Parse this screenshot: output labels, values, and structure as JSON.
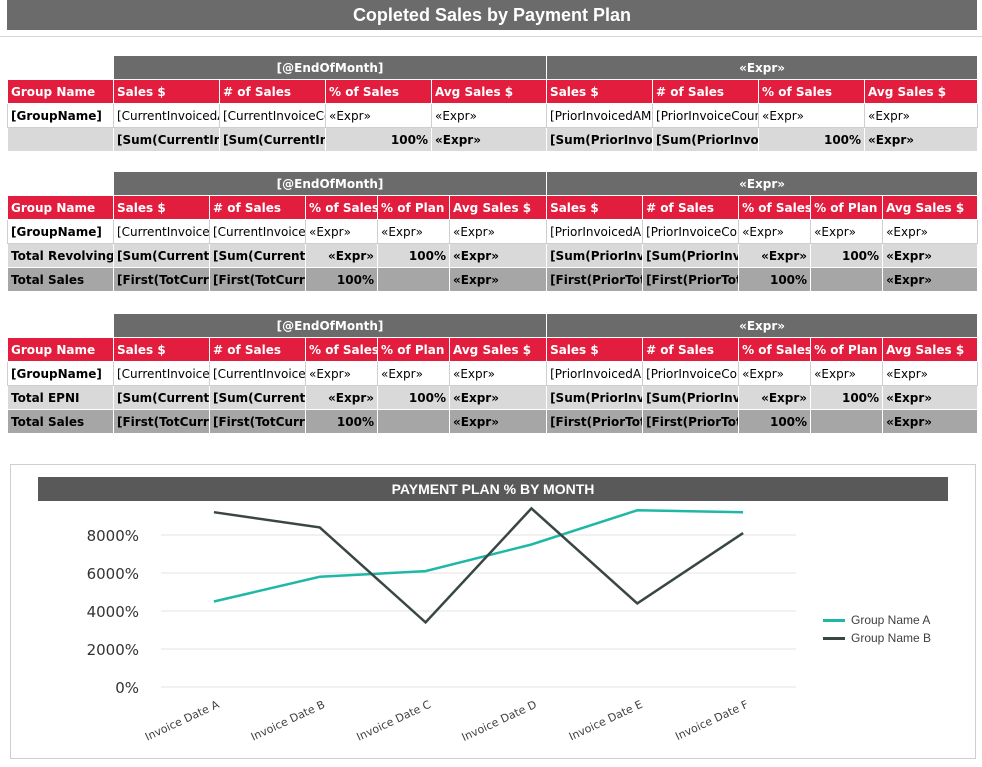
{
  "title": "Copleted Sales by Payment Plan",
  "colors": {
    "header_gray": "#6b6b6b",
    "header_red": "#e21d3d",
    "total_light": "#d9d9d9",
    "total_dark": "#a6a6a6",
    "series_a": "#1fb8a6",
    "series_b": "#3a4645"
  },
  "table1": {
    "group_current": "[@EndOfMonth]",
    "group_prior": "«Expr»",
    "headers": [
      "Group Name",
      "Sales $",
      "# of Sales",
      "% of Sales",
      "Avg Sales $",
      "Sales $",
      "# of Sales",
      "% of Sales",
      "Avg Sales $"
    ],
    "data_row": [
      "[GroupName]",
      "[CurrentInvoicedA",
      "[CurrentInvoiceCo",
      "«Expr»",
      "«Expr»",
      "[PriorInvoicedAM",
      "[PriorInvoiceCoun",
      "«Expr»",
      "«Expr»"
    ],
    "total_row": [
      "",
      "[Sum(CurrentInv",
      "[Sum(CurrentInv",
      "100%",
      "«Expr»",
      "[Sum(PriorInvoi",
      "[Sum(PriorInvoi",
      "100%",
      "«Expr»"
    ]
  },
  "table2": {
    "group_current": "[@EndOfMonth]",
    "group_prior": "«Expr»",
    "headers": [
      "Group Name",
      "Sales $",
      "# of Sales",
      "% of Sales",
      "% of Plan",
      "Avg Sales $",
      "Sales $",
      "# of Sales",
      "% of Sales",
      "% of Plan",
      "Avg Sales $"
    ],
    "data_row": [
      "[GroupName]",
      "[CurrentInvoice",
      "[CurrentInvoice",
      "«Expr»",
      "«Expr»",
      "«Expr»",
      "[PriorInvoicedA",
      "[PriorInvoiceCo",
      "«Expr»",
      "«Expr»",
      "«Expr»"
    ],
    "total_row": [
      "Total Revolving",
      "[Sum(CurrentI",
      "[Sum(CurrentI",
      "«Expr»",
      "100%",
      "«Expr»",
      "[Sum(PriorInv",
      "[Sum(PriorInv",
      "«Expr»",
      "100%",
      "«Expr»"
    ],
    "grand_row": [
      "Total Sales",
      "[First(TotCurre",
      "[First(TotCurre",
      "100%",
      "",
      "«Expr»",
      "[First(PriorTot",
      "[First(PriorTot",
      "100%",
      "",
      "«Expr»"
    ]
  },
  "table3": {
    "group_current": "[@EndOfMonth]",
    "group_prior": "«Expr»",
    "headers": [
      "Group Name",
      "Sales $",
      "# of Sales",
      "% of Sales",
      "% of Plan",
      "Avg Sales $",
      "Sales $",
      "# of Sales",
      "% of Sales",
      "% of Plan",
      "Avg Sales $"
    ],
    "data_row": [
      "[GroupName]",
      "[CurrentInvoice",
      "[CurrentInvoice",
      "«Expr»",
      "«Expr»",
      "«Expr»",
      "[PriorInvoicedA",
      "[PriorInvoiceCo",
      "«Expr»",
      "«Expr»",
      "«Expr»"
    ],
    "total_row": [
      "Total EPNI",
      "[Sum(CurrentI",
      "[Sum(CurrentI",
      "«Expr»",
      "100%",
      "«Expr»",
      "[Sum(PriorInv",
      "[Sum(PriorInv",
      "«Expr»",
      "100%",
      "«Expr»"
    ],
    "grand_row": [
      "Total Sales",
      "[First(TotCurre",
      "[First(TotCurre",
      "100%",
      "",
      "«Expr»",
      "[First(PriorTot",
      "[First(PriorTot",
      "100%",
      "",
      "«Expr»"
    ]
  },
  "chart_title": "PAYMENT PLAN % BY MONTH",
  "chart_data": {
    "type": "line",
    "title": "PAYMENT PLAN % BY MONTH",
    "categories": [
      "Invoice Date A",
      "Invoice Date B",
      "Invoice Date C",
      "Invoice Date D",
      "Invoice Date E",
      "Invoice Date F"
    ],
    "series": [
      {
        "name": "Group Name A",
        "values": [
          4500,
          5800,
          6100,
          7500,
          9300,
          9200
        ]
      },
      {
        "name": "Group Name B",
        "values": [
          9200,
          8400,
          3400,
          9400,
          4400,
          8100
        ]
      }
    ],
    "ylim": [
      0,
      8000
    ],
    "yticks": [
      0,
      2000,
      4000,
      6000,
      8000
    ],
    "ytick_labels": [
      "0%",
      "2000%",
      "4000%",
      "6000%",
      "8000%"
    ],
    "legend": "right",
    "grid": true
  }
}
